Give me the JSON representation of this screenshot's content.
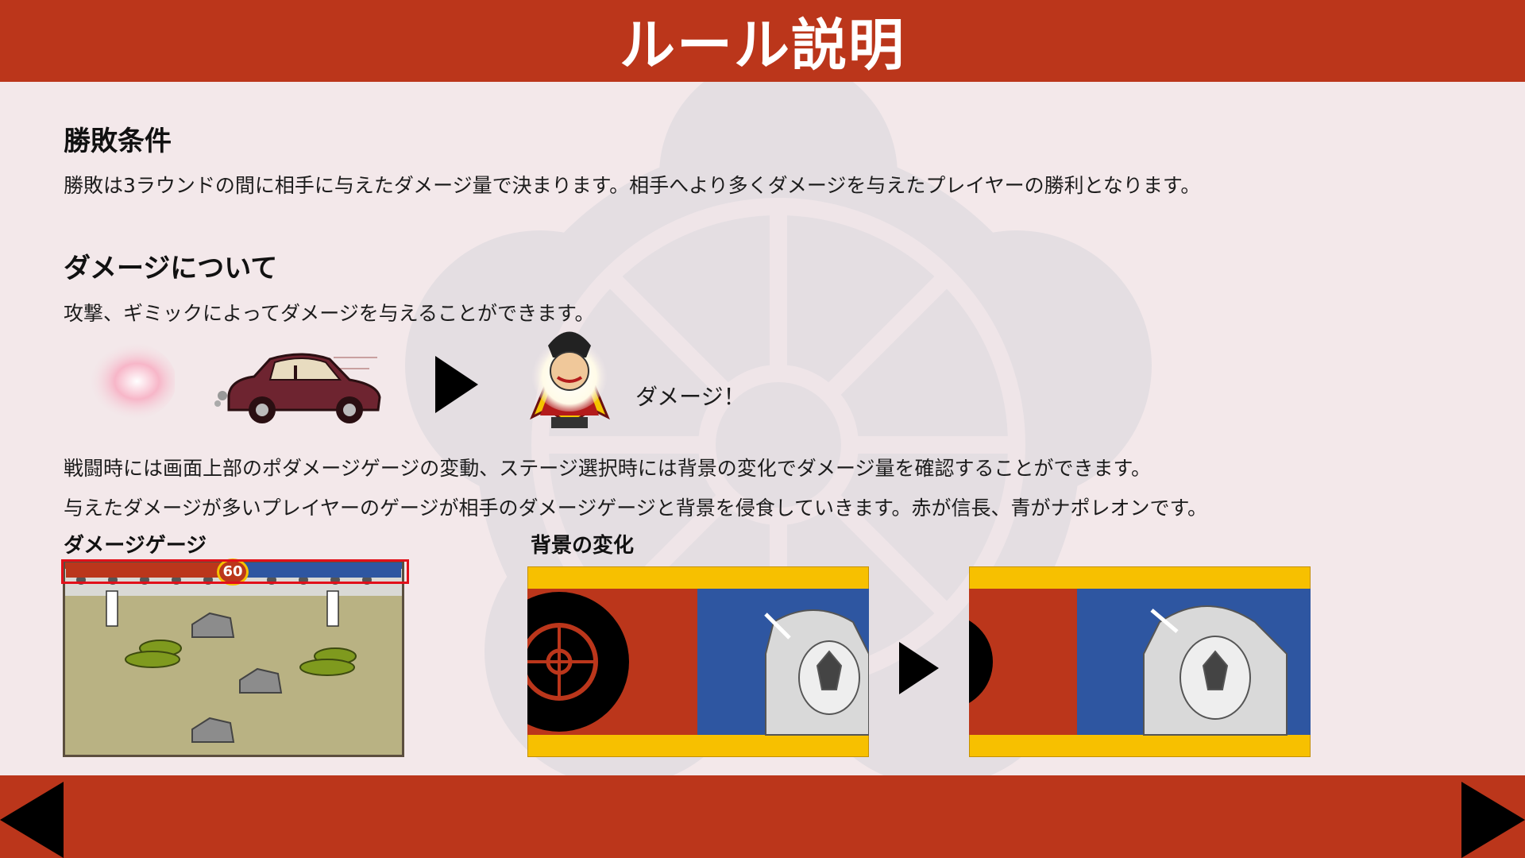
{
  "header": {
    "title": "ルール説明"
  },
  "sections": {
    "victory": {
      "heading": "勝敗条件",
      "text": "勝敗は3ラウンドの間に相手に与えたダメージ量で決まります。相手へより多くダメージを与えたプレイヤーの勝利となります。"
    },
    "damage": {
      "heading": "ダメージについて",
      "text": "攻撃、ギミックによってダメージを与えることができます。",
      "damage_label": "ダメージ！",
      "desc1": "戦闘時には画面上部のポダメージゲージの変動、ステージ選択時には背景の変化でダメージ量を確認することができます。",
      "desc2": "与えたダメージが多いプレイヤーのゲージが相手のダメージゲージと背景を侵食していきます。赤が信長、青がナポレオンです。"
    },
    "gauge": {
      "label": "ダメージゲージ",
      "timer": "60"
    },
    "background": {
      "label": "背景の変化"
    }
  },
  "colors": {
    "red": "#bb361b",
    "blue": "#2e56a1",
    "gold": "#f7c000",
    "page_bg": "#f3e8ea"
  },
  "icons": {
    "prev": "left-triangle-icon",
    "next": "right-triangle-icon"
  }
}
